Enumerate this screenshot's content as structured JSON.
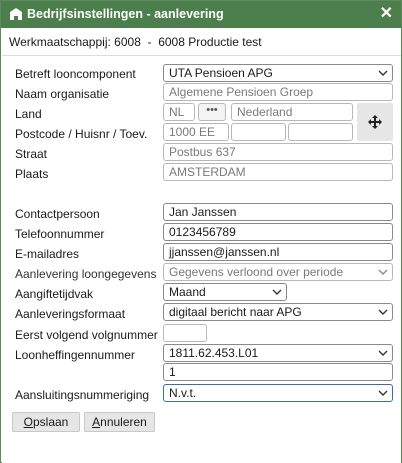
{
  "window": {
    "title": "Bedrijfsinstellingen - aanlevering",
    "close_label": "✕"
  },
  "company": {
    "label": "Werkmaatschappij:",
    "value": "6008  -  6008 Productie test"
  },
  "fields": {
    "betreft": {
      "label": "Betreft looncomponent",
      "value": "UTA Pensioen APG"
    },
    "naam_org": {
      "label": "Naam organisatie",
      "value": "Algemene Pensioen Groep"
    },
    "land": {
      "label": "Land",
      "code": "NL",
      "dots": "•••",
      "name": "Nederland"
    },
    "postcode": {
      "label": "Postcode / Huisnr / Toev.",
      "postcode": "1000 EE",
      "huisnr": "",
      "toev": ""
    },
    "straat": {
      "label": "Straat",
      "value": "Postbus 637"
    },
    "plaats": {
      "label": "Plaats",
      "value": "AMSTERDAM"
    },
    "contact": {
      "label": "Contactpersoon",
      "value": "Jan Janssen"
    },
    "telefoon": {
      "label": "Telefoonnummer",
      "value": "0123456789"
    },
    "email": {
      "label": "E-mailadres",
      "value": "jjanssen@janssen.nl"
    },
    "aanlevering_loon": {
      "label": "Aanlevering loongegevens",
      "value": "Gegevens verloond over periode"
    },
    "aangiftetijdvak": {
      "label": "Aangiftetijdvak",
      "value": "Maand"
    },
    "aanleveringsformaat": {
      "label": "Aanleveringsformaat",
      "value": "digitaal bericht naar APG"
    },
    "volgnummer": {
      "label": "Eerst volgend volgnummer",
      "value": ""
    },
    "loonheffing": {
      "label": "Loonheffingennummer",
      "value": "1811.62.453.L01",
      "extra": "1"
    },
    "aansluiting": {
      "label": "Aansluitingsnummeriging",
      "value": "N.v.t."
    }
  },
  "buttons": {
    "save_underlined": "O",
    "save_rest": "pslaan",
    "cancel_underlined": "A",
    "cancel_rest": "nnuleren"
  },
  "colors": {
    "titlebar": "#4d7f4d",
    "highlight_border": "#3a6ea8"
  },
  "icons": {
    "title": "building-icon",
    "move": "move-arrows-icon",
    "dropdown": "chevron-down-icon"
  }
}
